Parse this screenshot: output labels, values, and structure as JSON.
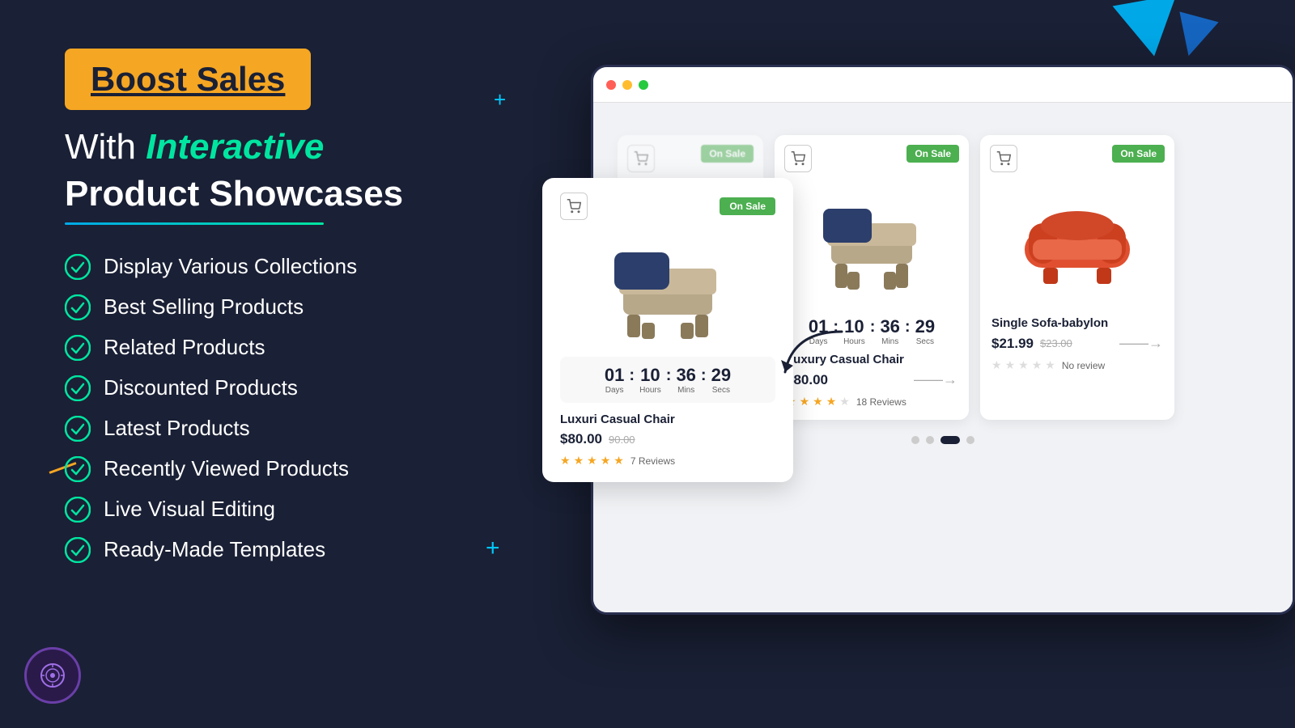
{
  "hero": {
    "badge_text": "Boost Sales",
    "headline_with": "With",
    "headline_interactive": "Interactive",
    "headline_sub": "Product Showcases"
  },
  "features": [
    "Display Various Collections",
    "Best Selling Products",
    "Related Products",
    "Discounted Products",
    "Latest Products",
    "Recently Viewed Products",
    "Live Visual Editing",
    "Ready-Made Templates"
  ],
  "products": [
    {
      "id": 1,
      "name": "Luxuri Casual Chair",
      "price": "$80.00",
      "old_price": "90.00",
      "reviews": 7,
      "stars": 5,
      "on_sale": "On Sale",
      "countdown": {
        "days": "01",
        "hours": "10",
        "mins": "36",
        "secs": "29"
      }
    },
    {
      "id": 2,
      "name": "Luxury Casual Chair",
      "price": "$80.00",
      "old_price": "",
      "reviews": 18,
      "stars": 3.5,
      "on_sale": "On Sale"
    },
    {
      "id": 3,
      "name": "Single Sofa-babylon",
      "price": "$21.99",
      "old_price": "$23.00",
      "reviews": 0,
      "review_text": "No review",
      "stars": 0,
      "on_sale": "On Sale"
    }
  ],
  "countdown": {
    "days_label": "Days",
    "hours_label": "Hours",
    "mins_label": "Mins",
    "secs_label": "Secs",
    "days_val": "01",
    "hours_val": "10",
    "mins_val": "36",
    "secs_val": "29"
  },
  "pagination": {
    "dots": 4,
    "active_index": 2
  },
  "icons": {
    "check": "✓",
    "cart": "🛒",
    "star_full": "★",
    "star_empty": "☆"
  }
}
